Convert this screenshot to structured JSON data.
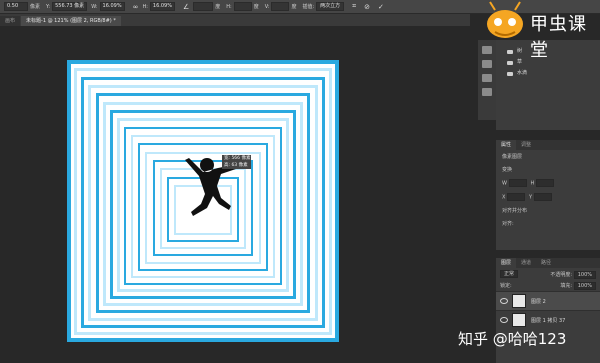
{
  "options_bar": {
    "x_prefix": "0.50",
    "x_unit": "像素",
    "y_label": "Y:",
    "y_value": "556.73 像素",
    "w_label": "W:",
    "w_value": "16.09%",
    "h_label": "H:",
    "h_value": "16.09%",
    "angle_label": "度",
    "h2_label": "H:",
    "h2_unit": "度",
    "v_label": "V:",
    "v_unit": "度",
    "interp_label": "插值:",
    "interp_value": "两次立方"
  },
  "tabs": [
    {
      "label": "画布"
    },
    {
      "label": "未标题-1 @ 121% (图层 2, RGB/8#) *"
    }
  ],
  "transform_tooltip": {
    "w": "宽: 566 像素",
    "h": "高: 63 像素"
  },
  "library": {
    "items": [
      {
        "label": "树"
      },
      {
        "label": "草"
      },
      {
        "label": "水滴"
      }
    ]
  },
  "properties": {
    "tabs": [
      {
        "label": "属性"
      },
      {
        "label": "调整"
      }
    ],
    "pixel_layer": "像素图层",
    "transform_header": "变换",
    "w_label": "W",
    "h_label": "H",
    "x_label": "X",
    "y_label": "Y",
    "align_header": "对齐并分布",
    "align_label": "对齐:"
  },
  "layers_panel": {
    "tabs": [
      {
        "label": "图层"
      },
      {
        "label": "通道"
      },
      {
        "label": "路径"
      }
    ],
    "blend_mode": "正常",
    "opacity_label": "不透明度:",
    "opacity_value": "100%",
    "lock_label": "锁定:",
    "fill_label": "填充:",
    "fill_value": "100%",
    "layers": [
      {
        "name": "图层 2",
        "selected": true
      },
      {
        "name": "图层 1 拷贝 37",
        "selected": false
      }
    ]
  },
  "logo_text": "甲虫课堂",
  "watermark": "知乎 @哈哈123",
  "colors": {
    "accent_blue": "#2aa9e0",
    "light_blue": "#bfe8fb"
  }
}
